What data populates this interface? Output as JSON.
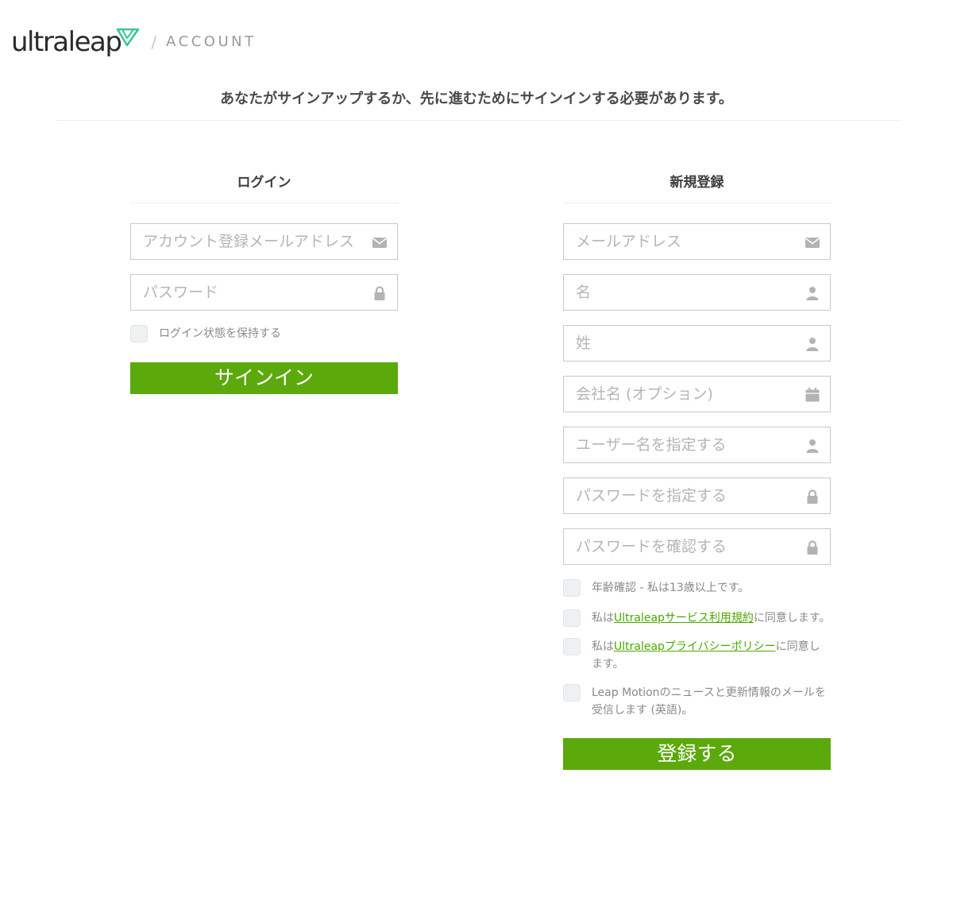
{
  "header": {
    "logo_text": "ultraleap",
    "separator": "/",
    "section": "ACCOUNT"
  },
  "notice": "あなたがサインアップするか、先に進むためにサインインする必要があります。",
  "login": {
    "title": "ログイン",
    "email_placeholder": "アカウント登録メールアドレス",
    "password_placeholder": "パスワード",
    "remember_label": "ログイン状態を保持する",
    "submit_label": "サインイン"
  },
  "register": {
    "title": "新規登録",
    "email_placeholder": "メールアドレス",
    "first_name_placeholder": "名",
    "last_name_placeholder": "姓",
    "company_placeholder": "会社名 (オプション)",
    "username_placeholder": "ユーザー名を指定する",
    "password_placeholder": "パスワードを指定する",
    "password_confirm_placeholder": "パスワードを確認する",
    "age_check": "年齢確認 - 私は13歳以上です。",
    "terms": {
      "prefix": "私は",
      "link": "Ultraleapサービス利用規約",
      "suffix": "に同意します。"
    },
    "privacy": {
      "prefix": "私は",
      "link": "Ultraleapプライバシーポリシー",
      "suffix": "に同意します。"
    },
    "newsletter": "Leap Motionのニュースと更新情報のメールを受信します (英語)。",
    "submit_label": "登録する"
  },
  "colors": {
    "accent_green": "#5ba90a",
    "link_green": "#4ca800",
    "logo_mark": "#36c98e"
  },
  "icons": {
    "email": "envelope-icon",
    "password": "lock-icon",
    "user": "user-icon",
    "company": "calendar-icon"
  }
}
